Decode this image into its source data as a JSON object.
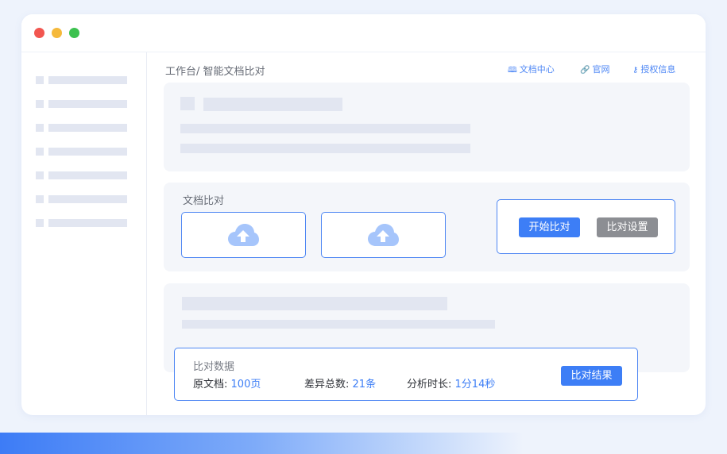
{
  "breadcrumb": {
    "root": "工作台/",
    "current": "智能文档比对"
  },
  "header_links": [
    {
      "icon": "book-icon",
      "glyph": "🕮",
      "label": "文档中心"
    },
    {
      "icon": "link-icon",
      "glyph": "🔗",
      "label": "官网"
    },
    {
      "icon": "key-icon",
      "glyph": "⚷",
      "label": "授权信息"
    }
  ],
  "compare": {
    "title": "文档比对",
    "start_label": "开始比对",
    "settings_label": "比对设置"
  },
  "stats": {
    "title": "比对数据",
    "original_label": "原文档:",
    "original_value": "100页",
    "diff_label": "差异总数:",
    "diff_value": "21条",
    "time_label": "分析时长:",
    "time_value": "1分14秒",
    "result_label": "比对结果"
  },
  "colors": {
    "accent": "#3d7ef6",
    "border": "#4f87f3",
    "upload_icon": "#a6c5fb",
    "placeholder": "#e2e6f1"
  }
}
